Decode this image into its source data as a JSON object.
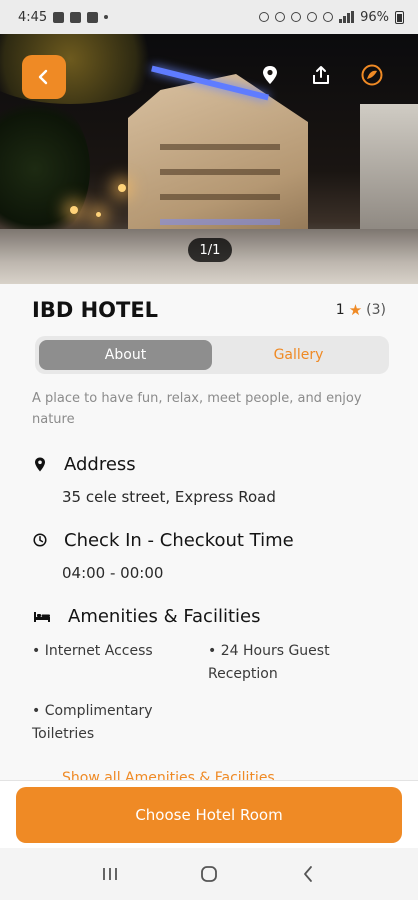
{
  "status": {
    "time": "4:45",
    "battery": "96%"
  },
  "hero": {
    "image_counter": "1/1",
    "icons": [
      "back-icon",
      "location-pin-icon",
      "share-icon",
      "map-icon"
    ]
  },
  "hotel": {
    "name": "IBD HOTEL",
    "rating": "1",
    "review_count": "(3)"
  },
  "tabs": [
    {
      "label": "About",
      "active": true
    },
    {
      "label": "Gallery",
      "active": false
    }
  ],
  "description": "A place to have fun, relax, meet people, and enjoy nature",
  "address": {
    "title": "Address",
    "value": "35 cele street, Express Road"
  },
  "checkin": {
    "title": "Check In - Checkout Time",
    "value": "04:00 - 00:00"
  },
  "amenities": {
    "title": "Amenities & Facilities",
    "items": [
      "• Internet Access",
      "• 24 Hours Guest Reception",
      "• Complimentary Toiletries"
    ],
    "show_all": "Show all Amenities & Facilities"
  },
  "cta": {
    "label": "Choose Hotel Room"
  },
  "colors": {
    "accent": "#ef8a25",
    "tab_active": "#8e8e8e"
  }
}
